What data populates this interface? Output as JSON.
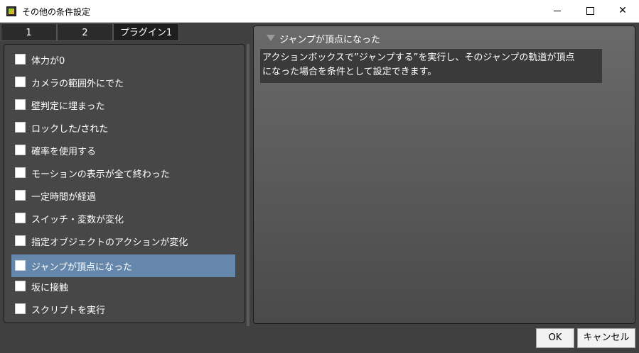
{
  "window": {
    "title": "その他の条件設定",
    "app_icon": "app-icon"
  },
  "tabs": [
    {
      "label": "1"
    },
    {
      "label": "2"
    },
    {
      "label": "プラグイン1"
    }
  ],
  "conditions": [
    {
      "label": "体力が0",
      "checked": false
    },
    {
      "label": "カメラの範囲外にでた",
      "checked": false
    },
    {
      "label": "壁判定に埋まった",
      "checked": false
    },
    {
      "label": "ロックした/された",
      "checked": false
    },
    {
      "label": "確率を使用する",
      "checked": false
    },
    {
      "label": "モーションの表示が全て終わった",
      "checked": false
    },
    {
      "label": "一定時間が経過",
      "checked": false
    },
    {
      "label": "スイッチ・変数が変化",
      "checked": false
    },
    {
      "label": "指定オブジェクトのアクションが変化",
      "checked": false
    },
    {
      "label": "ジャンプが頂点になった",
      "checked": false,
      "selected": true
    },
    {
      "label": "坂に接触",
      "checked": false
    },
    {
      "label": "スクリプトを実行",
      "checked": false
    }
  ],
  "detail": {
    "title": "ジャンプが頂点になった",
    "description_line1": "アクションボックスで”ジャンプする”を実行し、そのジャンプの軌道が頂点",
    "description_line2": "になった場合を条件として設定できます。"
  },
  "buttons": {
    "ok": "OK",
    "cancel": "キャンセル"
  },
  "colors": {
    "selection": "#6587ab",
    "background": "#404040"
  }
}
